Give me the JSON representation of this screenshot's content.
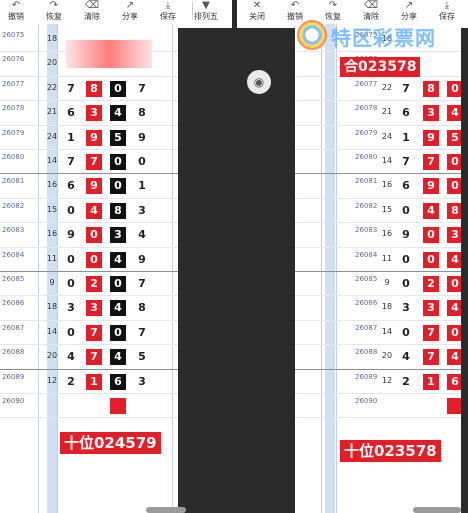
{
  "left": {
    "toolbar": [
      {
        "icon": "undo-icon",
        "glyph": "↶",
        "label": "撤销"
      },
      {
        "icon": "redo-icon",
        "glyph": "↷",
        "label": "恢复"
      },
      {
        "icon": "clear-icon",
        "glyph": "⌫",
        "label": "清除"
      },
      {
        "icon": "share-icon",
        "glyph": "↗",
        "label": "分享"
      },
      {
        "icon": "save-icon",
        "glyph": "⤓",
        "label": "保存"
      },
      {
        "icon": "dropdown-icon",
        "glyph": "▼",
        "label": "排列五"
      }
    ],
    "footer_banner": "十位024579"
  },
  "right": {
    "toolbar": [
      {
        "icon": "close-icon",
        "glyph": "✕",
        "label": "关闭"
      },
      {
        "icon": "undo-icon",
        "glyph": "↶",
        "label": "撤销"
      },
      {
        "icon": "redo-icon",
        "glyph": "↷",
        "label": "恢复"
      },
      {
        "icon": "clear-icon",
        "glyph": "⌫",
        "label": "清除"
      },
      {
        "icon": "share-icon",
        "glyph": "↗",
        "label": "分享"
      },
      {
        "icon": "save-icon",
        "glyph": "⤓",
        "label": "保存"
      }
    ],
    "top_banner": "合023578",
    "footer_banner": "十位023578",
    "watermark": "特区彩票网"
  },
  "rows": [
    {
      "issue": "26075",
      "sub": "",
      "sum": "18",
      "d": [
        "",
        "",
        "",
        ""
      ]
    },
    {
      "issue": "26076",
      "sub": "",
      "sum": "20",
      "d": [
        "",
        "",
        "",
        ""
      ]
    },
    {
      "issue": "26077",
      "sub": "",
      "sum": "22",
      "d": [
        "7",
        "8",
        "0",
        "7"
      ]
    },
    {
      "issue": "26078",
      "sub": "",
      "sum": "21",
      "d": [
        "6",
        "3",
        "4",
        "8"
      ]
    },
    {
      "issue": "26079",
      "sub": "",
      "sum": "24",
      "d": [
        "1",
        "9",
        "5",
        "9"
      ]
    },
    {
      "issue": "26080",
      "sub": "",
      "sum": "14",
      "d": [
        "7",
        "7",
        "0",
        "0"
      ]
    },
    {
      "issue": "26081",
      "sub": "",
      "sum": "16",
      "d": [
        "6",
        "9",
        "0",
        "1"
      ]
    },
    {
      "issue": "26082",
      "sub": "",
      "sum": "15",
      "d": [
        "0",
        "4",
        "8",
        "3"
      ]
    },
    {
      "issue": "26083",
      "sub": "",
      "sum": "16",
      "d": [
        "9",
        "0",
        "3",
        "4"
      ]
    },
    {
      "issue": "26084",
      "sub": "",
      "sum": "11",
      "d": [
        "0",
        "0",
        "4",
        "9"
      ]
    },
    {
      "issue": "26085",
      "sub": "",
      "sum": "9",
      "d": [
        "0",
        "2",
        "0",
        "7"
      ]
    },
    {
      "issue": "26086",
      "sub": "",
      "sum": "18",
      "d": [
        "3",
        "3",
        "4",
        "8"
      ]
    },
    {
      "issue": "26087",
      "sub": "",
      "sum": "14",
      "d": [
        "0",
        "7",
        "0",
        "7"
      ]
    },
    {
      "issue": "26088",
      "sub": "",
      "sum": "20",
      "d": [
        "4",
        "7",
        "4",
        "5"
      ]
    },
    {
      "issue": "26089",
      "sub": "",
      "sum": "12",
      "d": [
        "2",
        "1",
        "6",
        "3"
      ]
    },
    {
      "issue": "26090",
      "sub": "",
      "sum": "",
      "d": [
        "",
        "",
        "",
        ""
      ]
    }
  ],
  "colors": {
    "red": "#e41e26",
    "black": "#111111",
    "band": "#cfe0f6"
  }
}
